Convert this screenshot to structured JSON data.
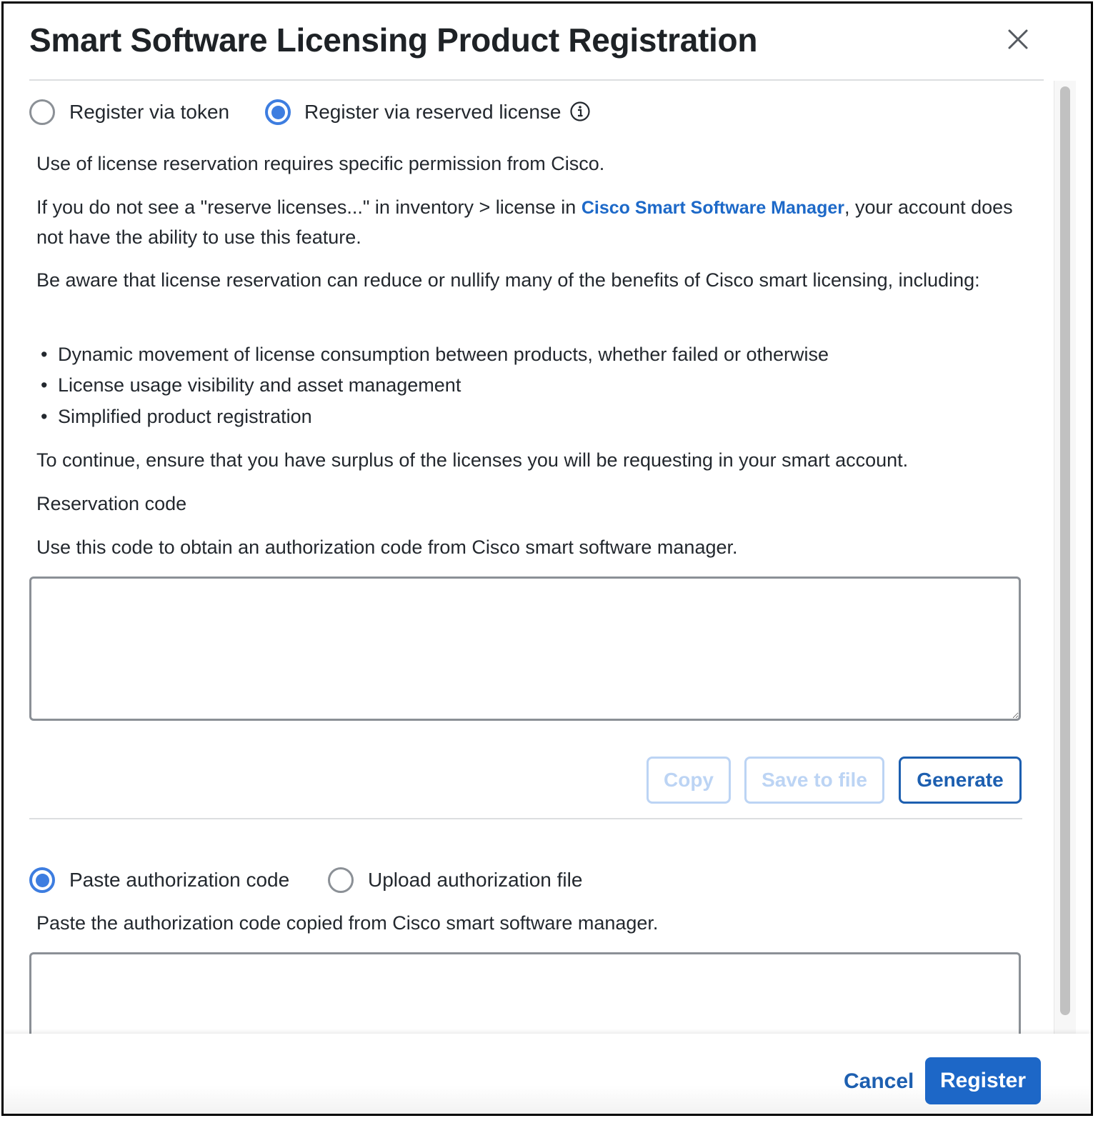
{
  "dialog": {
    "title": "Smart Software Licensing Product Registration",
    "close_icon": "close-icon"
  },
  "registration_mode": {
    "options": [
      {
        "label": "Register via token",
        "selected": false
      },
      {
        "label": "Register via reserved license",
        "selected": true
      }
    ],
    "info_icon": "info-circle-icon"
  },
  "content": {
    "para1": "Use of license reservation requires specific permission from Cisco.",
    "para2_before": "If you do not see a \"reserve licenses...\" in inventory > license in ",
    "para2_link": "Cisco Smart Software Manager",
    "para2_after": ", your account does not have the ability to use this feature.",
    "para3": "Be aware that license reservation can reduce or nullify many of the benefits of Cisco smart licensing, including:",
    "bullets": [
      "Dynamic movement of license consumption between products, whether failed or otherwise",
      "License usage visibility and asset management",
      "Simplified product registration"
    ],
    "para4": "To continue, ensure that you have surplus of the licenses you will be requesting in your smart account.",
    "reservation_label": "Reservation code",
    "reservation_help": "Use this code to obtain an authorization code from Cisco smart software manager.",
    "reservation_value": ""
  },
  "code_actions": {
    "copy": "Copy",
    "save": "Save to file",
    "generate": "Generate"
  },
  "auth_mode": {
    "options": [
      {
        "label": "Paste authorization code",
        "selected": true
      },
      {
        "label": "Upload authorization file",
        "selected": false
      }
    ],
    "help": "Paste the authorization code copied from Cisco smart software manager.",
    "value": ""
  },
  "footer": {
    "cancel": "Cancel",
    "register": "Register"
  },
  "colors": {
    "accent": "#1d67c7",
    "radio": "#3d7de0",
    "link": "#1d69c8"
  }
}
